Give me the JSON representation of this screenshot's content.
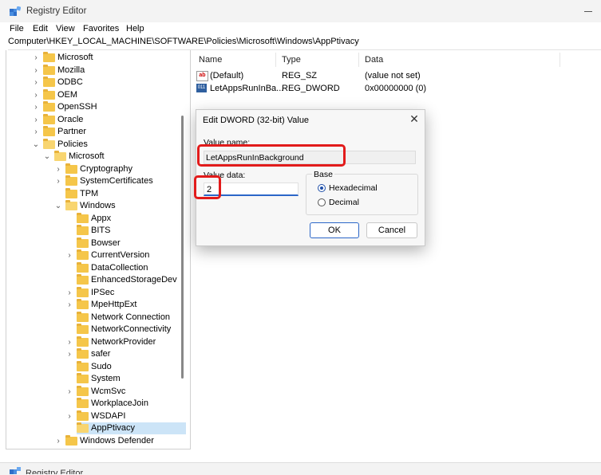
{
  "window": {
    "title": "Registry Editor"
  },
  "menu": [
    "File",
    "Edit",
    "View",
    "Favorites",
    "Help"
  ],
  "address": "Computer\\HKEY_LOCAL_MACHINE\\SOFTWARE\\Policies\\Microsoft\\Windows\\AppPtivacy",
  "tree": {
    "items": [
      {
        "label": "Microsoft",
        "chevron": "›"
      },
      {
        "label": "Mozilla",
        "chevron": "›"
      },
      {
        "label": "ODBC",
        "chevron": "›"
      },
      {
        "label": "OEM",
        "chevron": "›"
      },
      {
        "label": "OpenSSH",
        "chevron": "›"
      },
      {
        "label": "Oracle",
        "chevron": "›"
      },
      {
        "label": "Partner",
        "chevron": "›"
      },
      {
        "label": "Policies",
        "chevron": "⌄"
      },
      {
        "label": "Microsoft",
        "chevron": "⌄"
      },
      {
        "label": "Cryptography",
        "chevron": "›"
      },
      {
        "label": "SystemCertificates",
        "chevron": "›"
      },
      {
        "label": "TPM",
        "chevron": ""
      },
      {
        "label": "Windows",
        "chevron": "⌄"
      },
      {
        "label": "Appx",
        "chevron": ""
      },
      {
        "label": "BITS",
        "chevron": ""
      },
      {
        "label": "Bowser",
        "chevron": ""
      },
      {
        "label": "CurrentVersion",
        "chevron": "›"
      },
      {
        "label": "DataCollection",
        "chevron": ""
      },
      {
        "label": "EnhancedStorageDev",
        "chevron": ""
      },
      {
        "label": "IPSec",
        "chevron": "›"
      },
      {
        "label": "MpeHttpExt",
        "chevron": "›"
      },
      {
        "label": "Network Connection",
        "chevron": ""
      },
      {
        "label": "NetworkConnectivity",
        "chevron": ""
      },
      {
        "label": "NetworkProvider",
        "chevron": "›"
      },
      {
        "label": "safer",
        "chevron": "›"
      },
      {
        "label": "Sudo",
        "chevron": ""
      },
      {
        "label": "System",
        "chevron": ""
      },
      {
        "label": "WcmSvc",
        "chevron": "›"
      },
      {
        "label": "WorkplaceJoin",
        "chevron": ""
      },
      {
        "label": "WSDAPI",
        "chevron": "›"
      },
      {
        "label": "AppPtivacy",
        "chevron": ""
      },
      {
        "label": "Windows Defender",
        "chevron": "›"
      }
    ]
  },
  "list": {
    "columns": [
      "Name",
      "Type",
      "Data"
    ],
    "rows": [
      {
        "icon": "string-value-icon",
        "name": "(Default)",
        "type": "REG_SZ",
        "data": "(value not set)"
      },
      {
        "icon": "dword-value-icon",
        "name": "LetAppsRunInBa...",
        "type": "REG_DWORD",
        "data": "0x00000000 (0)"
      }
    ]
  },
  "dialog": {
    "title": "Edit DWORD (32-bit) Value",
    "close_glyph": "✕",
    "value_name_label": "Value name:",
    "value_name": "LetAppsRunInBackground",
    "value_data_label": "Value data:",
    "value_data": "2",
    "base_label": "Base",
    "base_options": [
      {
        "label": "Hexadecimal",
        "selected": true
      },
      {
        "label": "Decimal",
        "selected": false
      }
    ],
    "ok": "OK",
    "cancel": "Cancel"
  },
  "bottom_window": {
    "title": "Registry Editor"
  },
  "colors": {
    "highlight": "#e21b1b",
    "accent": "#2b66c8",
    "folder": "#f5c64a"
  }
}
